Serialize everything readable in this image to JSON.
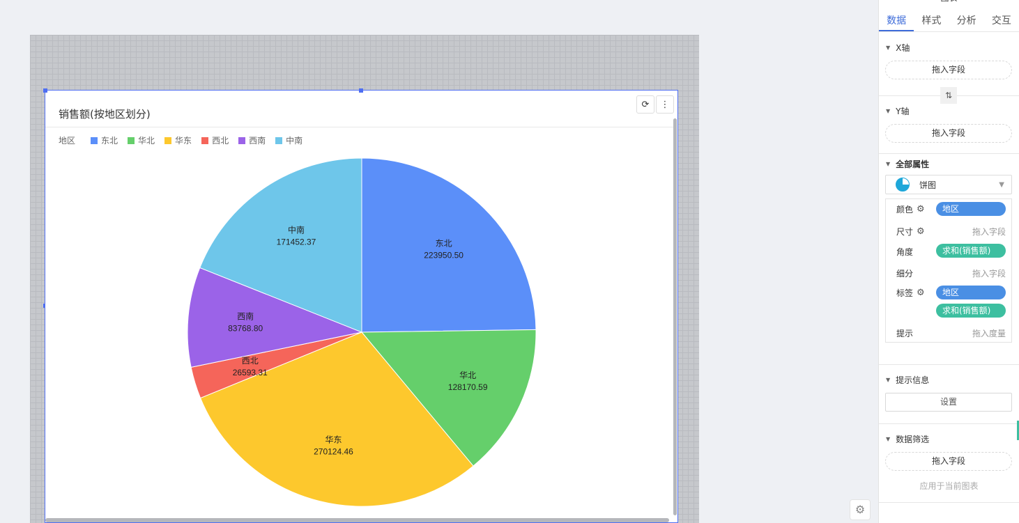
{
  "widget": {
    "title": "销售额(按地区划分)",
    "refresh_icon": "⟳",
    "more_icon": "⋮"
  },
  "legend": {
    "title": "地区",
    "items": [
      {
        "label": "东北",
        "color": "#5b8ff9"
      },
      {
        "label": "华北",
        "color": "#65cf6b"
      },
      {
        "label": "华东",
        "color": "#fdc82d"
      },
      {
        "label": "西北",
        "color": "#f5655a"
      },
      {
        "label": "西南",
        "color": "#9b63e8"
      },
      {
        "label": "中南",
        "color": "#6ec6ea"
      }
    ]
  },
  "chart_data": {
    "type": "pie",
    "categories": [
      "东北",
      "华北",
      "华东",
      "西北",
      "西南",
      "中南"
    ],
    "values": [
      223950.5,
      128170.59,
      270124.46,
      26593.31,
      83768.8,
      171452.37
    ],
    "value_labels": [
      "223950.50",
      "128170.59",
      "270124.46",
      "26593.31",
      "83768.80",
      "171452.37"
    ],
    "colors": [
      "#5b8ff9",
      "#65cf6b",
      "#fdc82d",
      "#f5655a",
      "#9b63e8",
      "#6ec6ea"
    ],
    "legend_title": "地区",
    "legend_position": "top-left"
  },
  "panel": {
    "header": "图表",
    "tabs": [
      "数据",
      "样式",
      "分析",
      "交互"
    ],
    "active_tab": "数据",
    "x_axis": {
      "title": "X轴",
      "drop": "拖入字段"
    },
    "swap_icon": "⇅",
    "y_axis": {
      "title": "Y轴",
      "drop": "拖入字段"
    },
    "all_props": {
      "title": "全部属性",
      "chart_type": "饼图",
      "rows": {
        "color": {
          "label": "颜色",
          "value": "地区"
        },
        "size": {
          "label": "尺寸",
          "hint": "拖入字段"
        },
        "angle": {
          "label": "角度",
          "value": "求和(销售额)"
        },
        "detail": {
          "label": "细分",
          "hint": "拖入字段"
        },
        "tag": {
          "label": "标签",
          "value1": "地区",
          "value2": "求和(销售额)"
        },
        "tooltip": {
          "label": "提示",
          "hint": "拖入度量"
        }
      }
    },
    "tooltip_section": {
      "title": "提示信息",
      "button": "设置"
    },
    "filter_section": {
      "title": "数据筛选",
      "drop": "拖入字段",
      "apply": "应用于当前图表"
    }
  }
}
